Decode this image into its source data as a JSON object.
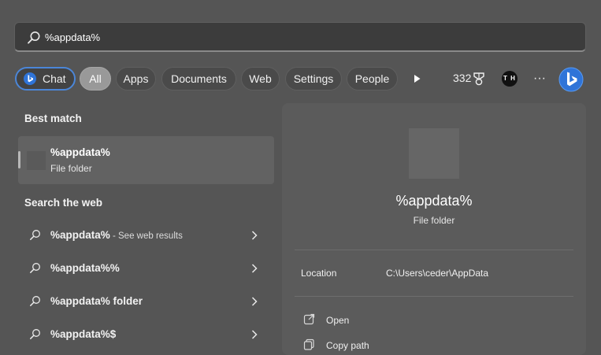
{
  "search": {
    "query": "%appdata%"
  },
  "filters": {
    "chat_label": "Chat",
    "tabs": [
      "All",
      "Apps",
      "Documents",
      "Web",
      "Settings",
      "People"
    ],
    "active_tab": "All",
    "points": "332",
    "avatar_initials": "T H"
  },
  "best_match": {
    "heading": "Best match",
    "name": "%appdata%",
    "type": "File folder"
  },
  "web_search": {
    "heading": "Search the web",
    "rows": [
      {
        "bold": "%appdata%",
        "suffix": " - See web results"
      },
      {
        "bold": "%appdata%%",
        "suffix": ""
      },
      {
        "bold": "%appdata%",
        "plain": " ",
        "bold2": "folder",
        "suffix": ""
      },
      {
        "bold": "%appdata%$",
        "suffix": ""
      }
    ]
  },
  "preview": {
    "name": "%appdata%",
    "type": "File folder",
    "location_label": "Location",
    "location_value": "C:\\Users\\ceder\\AppData",
    "actions": [
      "Open",
      "Copy path"
    ]
  },
  "colors": {
    "accent": "#4b86d8",
    "background": "#555555"
  },
  "icons": [
    "search-icon",
    "bing-icon",
    "play-icon",
    "medal-icon",
    "more-icon",
    "magnifier-icon",
    "chevron-right-icon",
    "open-external-icon",
    "copy-path-icon"
  ]
}
